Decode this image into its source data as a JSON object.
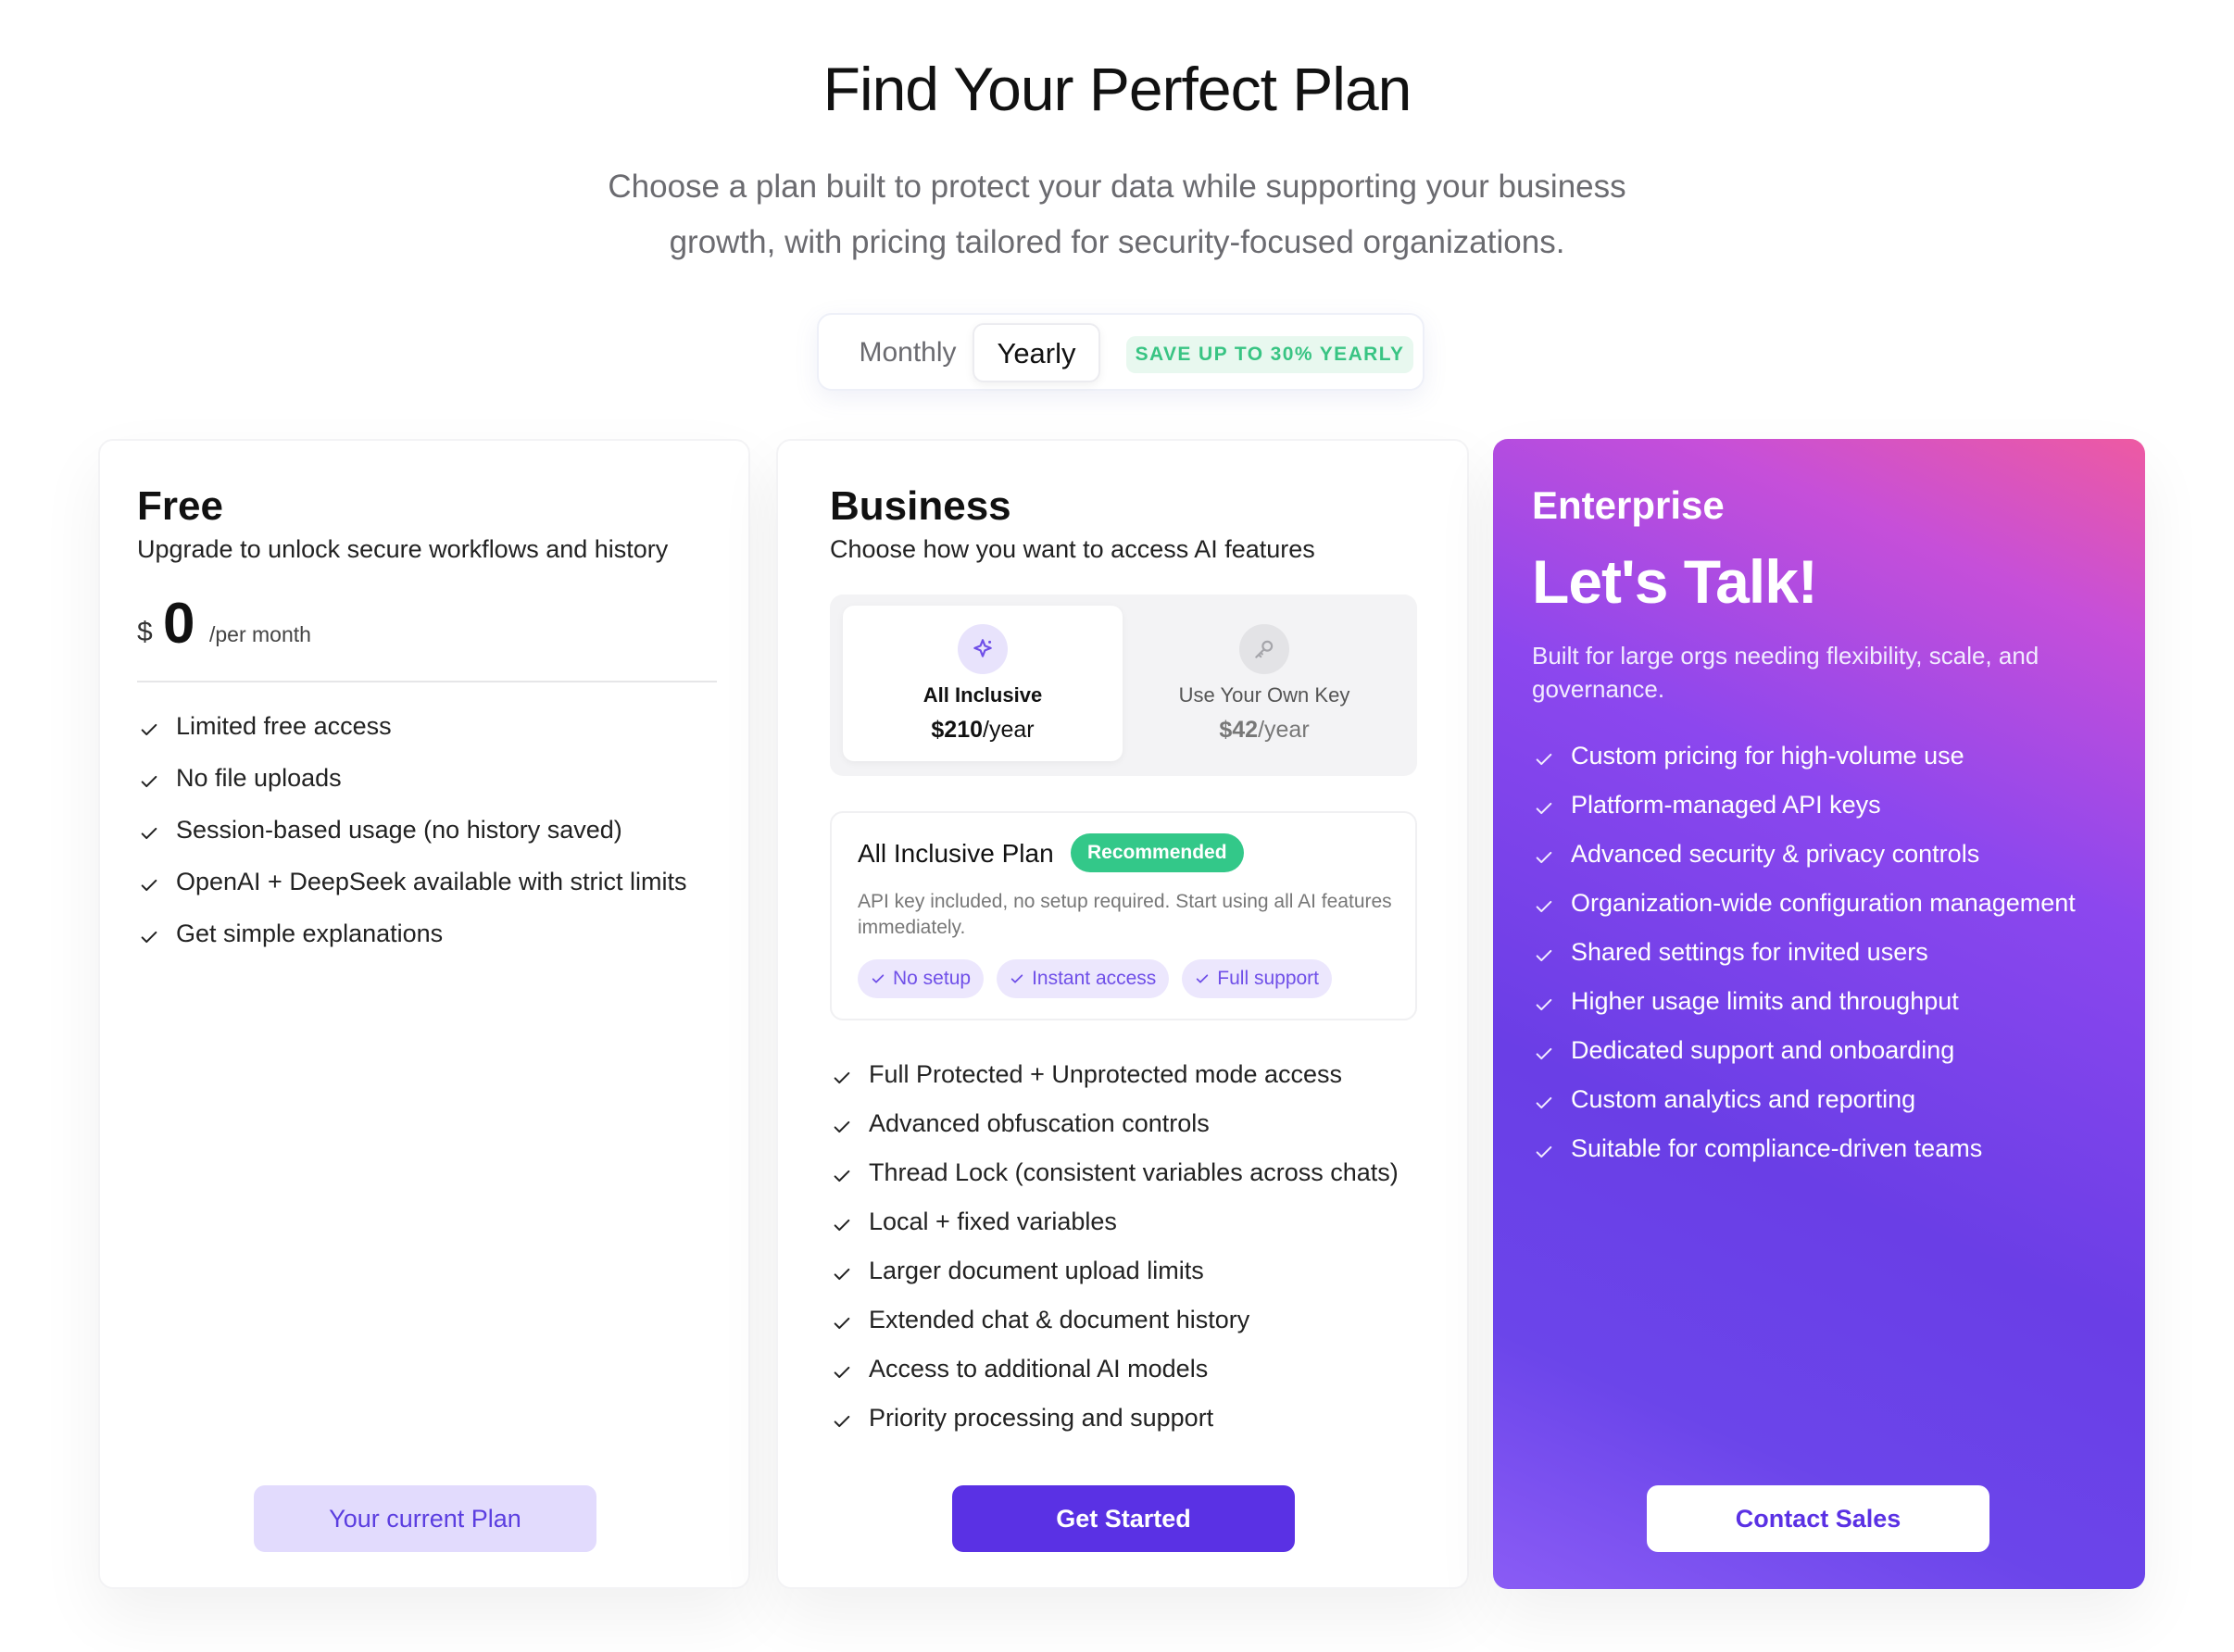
{
  "header": {
    "title": "Find Your Perfect Plan",
    "subtitle_line1": "Choose a plan built to protect your data while supporting your business",
    "subtitle_line2": "growth, with pricing tailored for security-focused organizations."
  },
  "billing": {
    "monthly_label": "Monthly",
    "yearly_label": "Yearly",
    "selected": "Yearly",
    "save_badge": "SAVE UP TO 30% YEARLY"
  },
  "colors": {
    "accent": "#5a31e4",
    "success": "#33c889",
    "enterprise_gradient_start": "#ee5aa2",
    "enterprise_gradient_end": "#6a3ee6"
  },
  "free": {
    "name": "Free",
    "description": "Upgrade to unlock secure workflows and history",
    "currency": "$",
    "price": "0",
    "period": "/per month",
    "features": [
      "Limited free access",
      "No file uploads",
      "Session-based usage (no history saved)",
      "OpenAI + DeepSeek available with strict limits",
      "Get simple explanations"
    ],
    "button": "Your current Plan"
  },
  "business": {
    "name": "Business",
    "description": "Choose how you want to access AI features",
    "options": [
      {
        "label": "All Inclusive",
        "price": "$210",
        "period": "/year",
        "icon": "sparkle-icon",
        "selected": true
      },
      {
        "label": "Use Your Own Key",
        "price": "$42",
        "period": "/year",
        "icon": "key-icon",
        "selected": false
      }
    ],
    "plan_info": {
      "title": "All Inclusive Plan",
      "badge": "Recommended",
      "description": "API key included, no setup required. Start using all AI features immediately.",
      "tags": [
        "No setup",
        "Instant access",
        "Full support"
      ]
    },
    "features": [
      "Full Protected + Unprotected mode access",
      "Advanced obfuscation controls",
      "Thread Lock (consistent variables across chats)",
      "Local + fixed variables",
      "Larger document upload limits",
      "Extended chat & document history",
      "Access to additional AI models",
      "Priority processing and support"
    ],
    "button": "Get Started"
  },
  "enterprise": {
    "name": "Enterprise",
    "headline": "Let's Talk!",
    "description": "Built for large orgs needing flexibility, scale, and governance.",
    "features": [
      "Custom pricing for high-volume use",
      "Platform-managed API keys",
      "Advanced security & privacy controls",
      "Organization-wide configuration management",
      "Shared settings for invited users",
      "Higher usage limits and throughput",
      "Dedicated support and onboarding",
      "Custom analytics and reporting",
      "Suitable for compliance-driven teams"
    ],
    "button": "Contact Sales"
  }
}
